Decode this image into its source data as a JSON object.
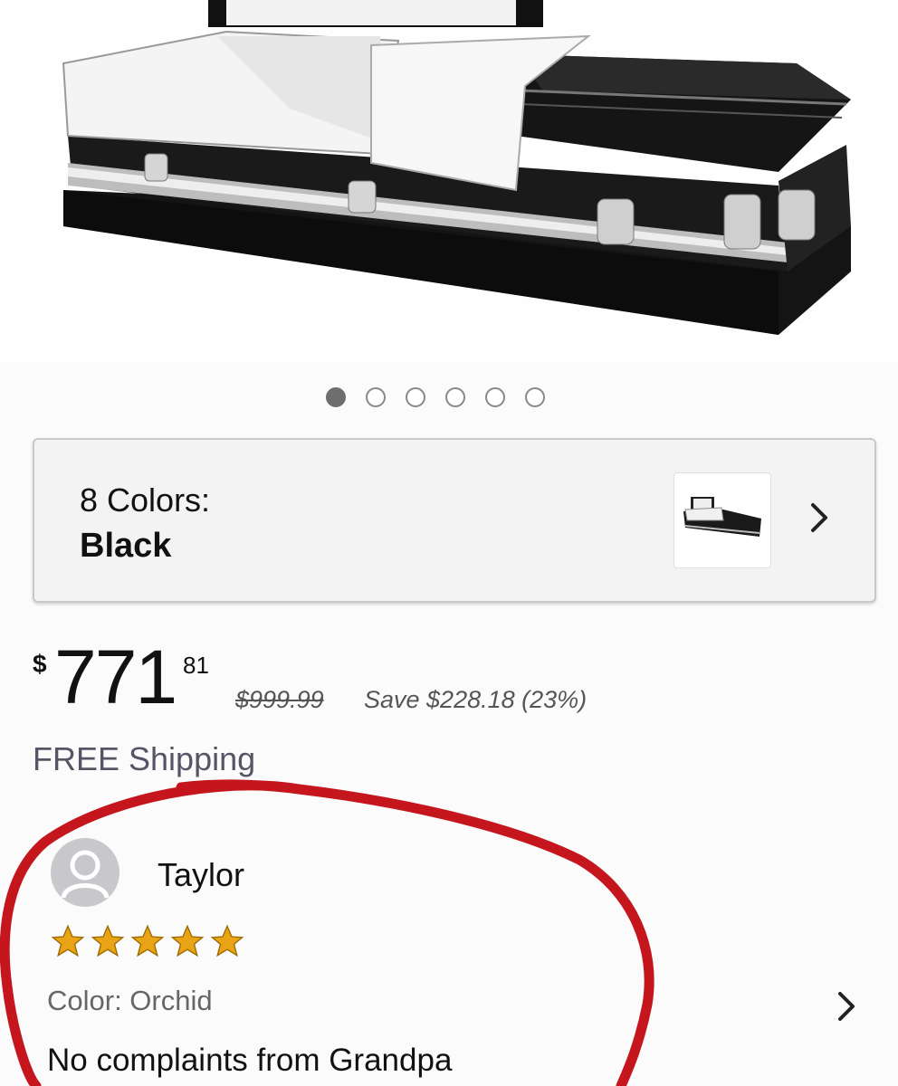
{
  "product": {
    "image_name": "casket-product-image",
    "carousel": {
      "total": 6,
      "active_index": 0
    }
  },
  "colors": {
    "count_label": "8 Colors:",
    "selected": "Black"
  },
  "price": {
    "currency": "$",
    "whole": "771",
    "cents": "81",
    "list_price": "$999.99",
    "savings": "Save $228.18 (23%)"
  },
  "shipping": "FREE Shipping",
  "review": {
    "reviewer": "Taylor",
    "rating": 5,
    "rating_max": 5,
    "color_line": "Color: Orchid",
    "text": "No complaints from Grandpa"
  },
  "colors_theme": {
    "annotation_circle": "#c4161c",
    "star": "#e8a317",
    "shipping_text": "#556"
  }
}
